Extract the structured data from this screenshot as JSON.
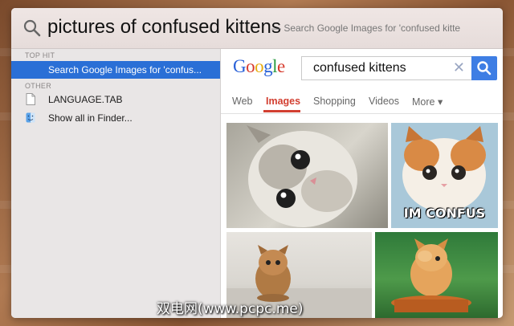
{
  "spotlight": {
    "query": "pictures of confused kittens",
    "hint": "— Search Google Images for 'confused kitte"
  },
  "sidebar": {
    "sections": [
      {
        "label": "TOP HIT"
      },
      {
        "label": "OTHER"
      }
    ],
    "items": [
      {
        "label": "Search Google Images for 'confus...",
        "icon": "google-icon",
        "selected": true
      },
      {
        "label": "LANGUAGE.TAB",
        "icon": "document-icon",
        "selected": false
      },
      {
        "label": "Show all in Finder...",
        "icon": "finder-icon",
        "selected": false
      }
    ]
  },
  "google": {
    "logo": "Google",
    "search_value": "confused kittens",
    "clear_symbol": "✕",
    "tabs": [
      "Web",
      "Images",
      "Shopping",
      "Videos",
      "More ▾"
    ],
    "active_tab": "Images"
  },
  "results": {
    "image_caption": "IM CONFUS"
  },
  "watermark": "双电网(www.pcpc.me)",
  "colors": {
    "selection": "#2a6fd6",
    "google_blue": "#3e7ee4",
    "active_tab": "#d23f31"
  }
}
